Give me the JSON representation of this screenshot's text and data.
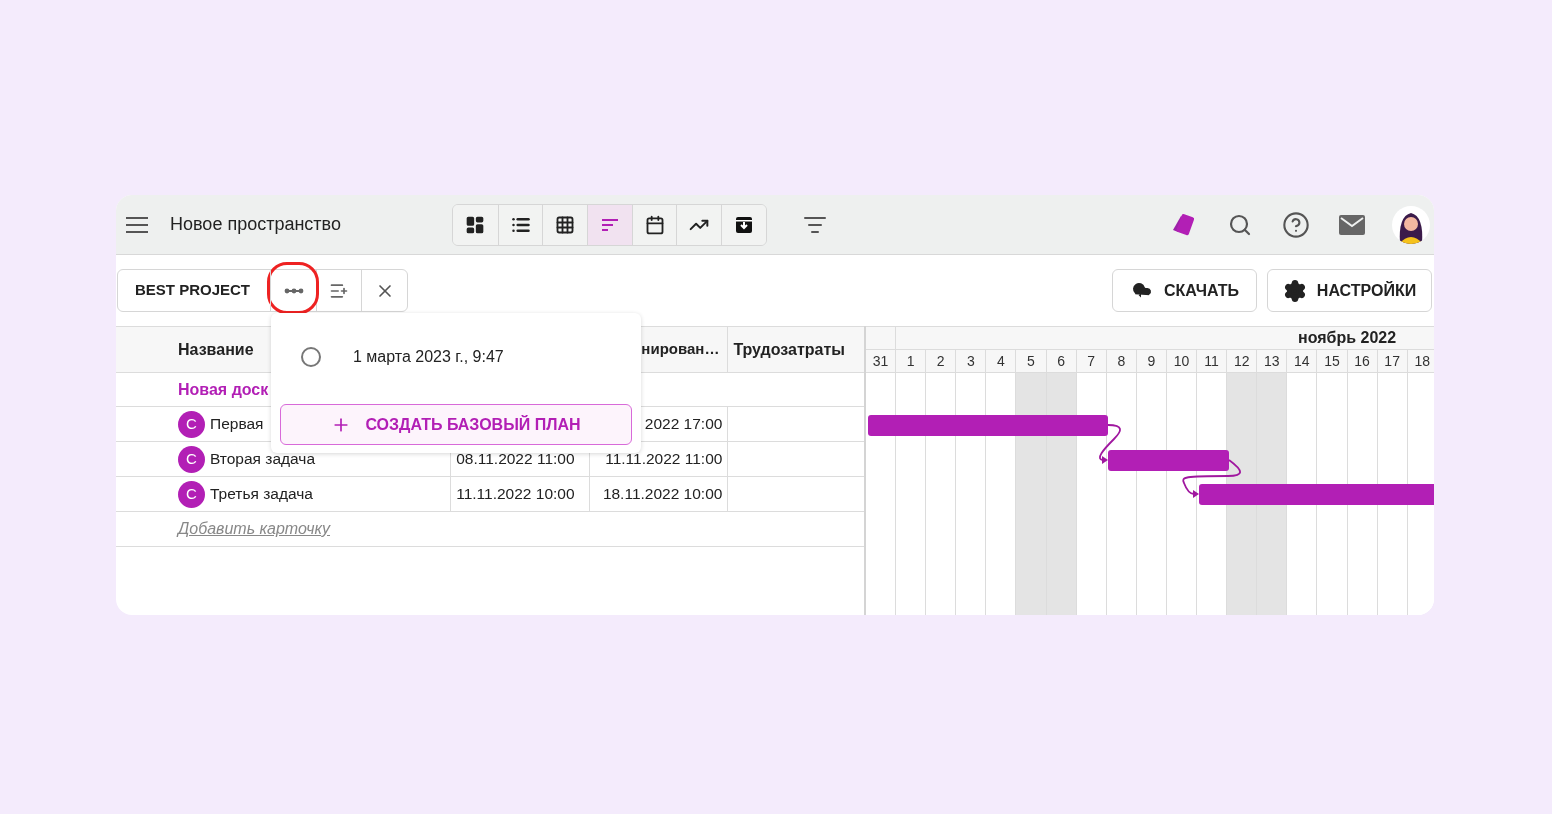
{
  "header": {
    "title": "Новое пространство",
    "views": [
      {
        "kind": "dashboard",
        "selected": false
      },
      {
        "kind": "list",
        "selected": false
      },
      {
        "kind": "table",
        "selected": false
      },
      {
        "kind": "gantt",
        "selected": true
      },
      {
        "kind": "calendar",
        "selected": false
      },
      {
        "kind": "chart",
        "selected": false
      },
      {
        "kind": "archive",
        "selected": false
      }
    ]
  },
  "toolbar": {
    "project": "BEST PROJECT",
    "download": "СКАЧАТЬ",
    "settings": "НАСТРОЙКИ"
  },
  "baseline_menu": {
    "options": [
      {
        "label": "1 марта 2023 г., 9:47",
        "selected": false
      }
    ],
    "create_button": "СОЗДАТЬ БАЗОВЫЙ ПЛАН"
  },
  "table": {
    "columns": [
      "Название",
      "нирован…",
      "Трудозатраты"
    ],
    "group": "Новая доск",
    "rows": [
      {
        "avatar": "С",
        "name": "Первая",
        "end": "2022 17:00"
      },
      {
        "avatar": "С",
        "name": "Вторая задача",
        "start": "08.11.2022 11:00",
        "end": "11.11.2022 11:00"
      },
      {
        "avatar": "С",
        "name": "Третья задача",
        "start": "11.11.2022 10:00",
        "end": "18.11.2022 10:00"
      }
    ],
    "add_link": "Добавить карточку"
  },
  "gantt": {
    "month": "ноябрь 2022",
    "days": [
      {
        "label": "31",
        "weekend": false
      },
      {
        "label": "1",
        "weekend": false
      },
      {
        "label": "2",
        "weekend": false
      },
      {
        "label": "3",
        "weekend": false
      },
      {
        "label": "4",
        "weekend": false
      },
      {
        "label": "5",
        "weekend": true
      },
      {
        "label": "6",
        "weekend": true
      },
      {
        "label": "7",
        "weekend": false
      },
      {
        "label": "8",
        "weekend": false
      },
      {
        "label": "9",
        "weekend": false
      },
      {
        "label": "10",
        "weekend": false
      },
      {
        "label": "11",
        "weekend": false
      },
      {
        "label": "12",
        "weekend": true
      },
      {
        "label": "13",
        "weekend": true
      },
      {
        "label": "14",
        "weekend": false
      },
      {
        "label": "15",
        "weekend": false
      },
      {
        "label": "16",
        "weekend": false
      },
      {
        "label": "17",
        "weekend": false
      },
      {
        "label": "18",
        "weekend": false
      }
    ]
  }
}
